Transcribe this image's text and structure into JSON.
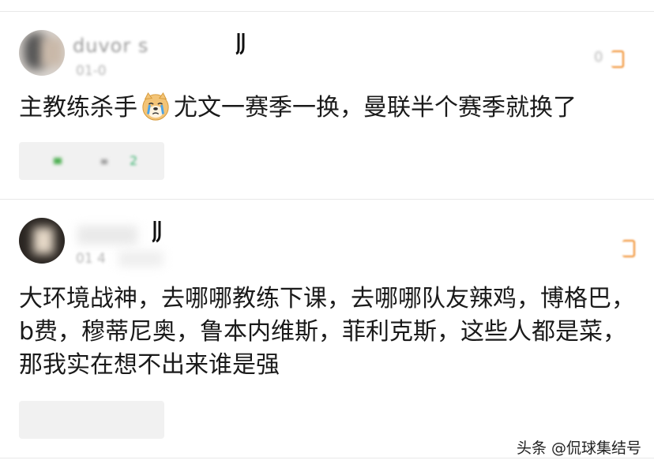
{
  "comments": [
    {
      "username": "duvor s",
      "timestamp": "01-0",
      "like_count": "0",
      "text_before_emoji": "主教练杀手",
      "emoji_name": "crying-doge-emoji",
      "text_after_emoji": "尤文一赛季一换，曼联半个赛季就换了",
      "replies_preview": "2"
    },
    {
      "username": "",
      "timestamp": "01 4",
      "like_count": "",
      "text": "大环境战神，去哪哪教练下课，去哪哪队友辣鸡，博格巴，b费，穆蒂尼奥，鲁本内维斯，菲利克斯，这些人都是菜，那我实在想不出来谁是强",
      "replies_preview": ""
    }
  ],
  "watermark": "头条 @侃球集结号",
  "colors": {
    "like_icon": "#f08a24",
    "reply_box": "#f1f1f1",
    "reply_text": "#3cb371"
  }
}
